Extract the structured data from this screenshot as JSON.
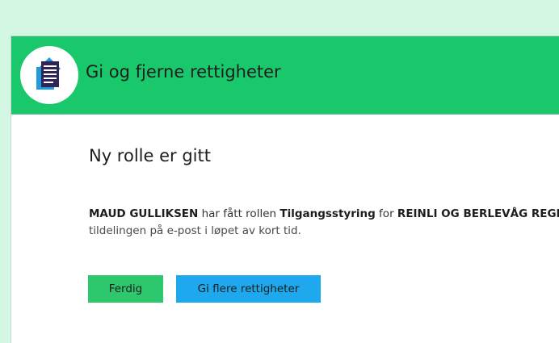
{
  "header": {
    "title": "Gi og fjerne rettigheter",
    "logo_icon": "documents-icon"
  },
  "content": {
    "title": "Ny rolle er gitt",
    "message": {
      "person": "MAUD GULLIKSEN",
      "text1": " har fått rollen ",
      "role": "Tilgangsstyring",
      "text2": " for ",
      "organization": "REINLI OG BERLEVÅG REGNSKAP",
      "line2": "tildelingen på e-post i løpet av kort tid."
    }
  },
  "buttons": {
    "done_label": "Ferdig",
    "more_label": "Gi flere rettigheter"
  },
  "colors": {
    "background": "#d4f7e3",
    "header": "#1ac86c",
    "done_button": "#2dc86e",
    "more_button": "#1ea9ef"
  }
}
